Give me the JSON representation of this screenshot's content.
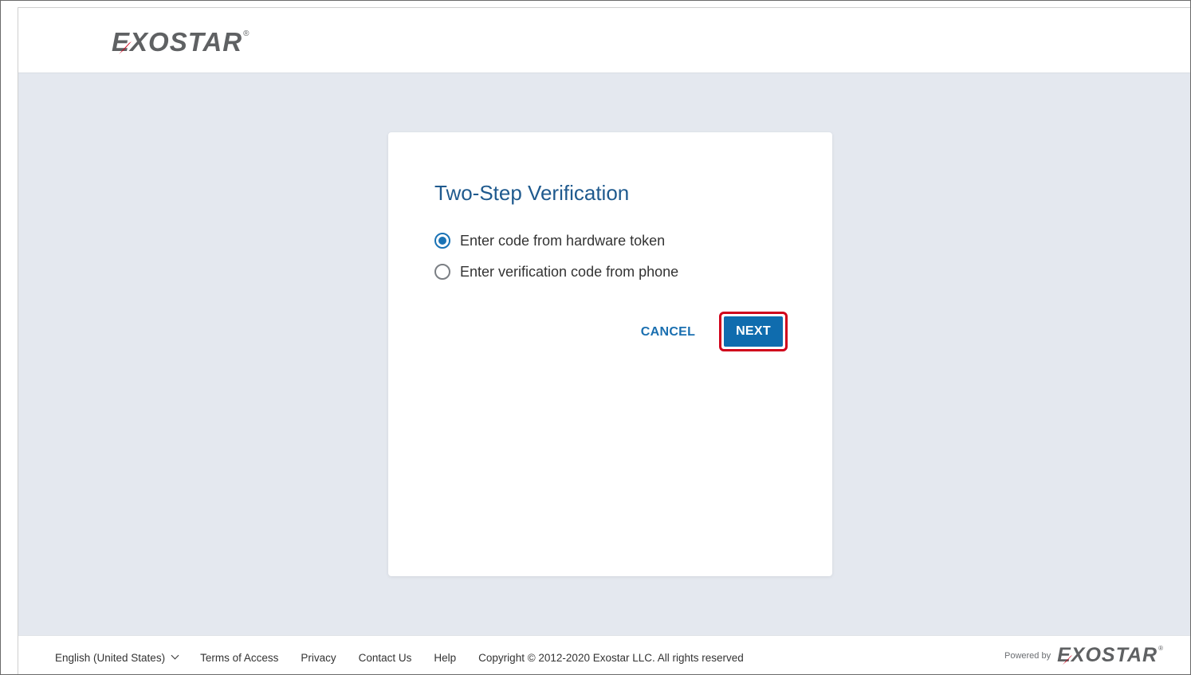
{
  "brand": {
    "name": "EXOSTAR",
    "registered_mark": "®",
    "primary_color": "#0f6cae",
    "accent_color": "#d0021b"
  },
  "dialog": {
    "title": "Two-Step Verification",
    "options": [
      {
        "label": "Enter code from hardware token",
        "selected": true
      },
      {
        "label": "Enter verification code from phone",
        "selected": false
      }
    ],
    "cancel_label": "CANCEL",
    "next_label": "NEXT"
  },
  "footer": {
    "language": "English (United States)",
    "links": [
      "Terms of Access",
      "Privacy",
      "Contact Us",
      "Help"
    ],
    "copyright": "Copyright © 2012-2020 Exostar LLC. All rights reserved",
    "powered_by": "Powered by"
  }
}
